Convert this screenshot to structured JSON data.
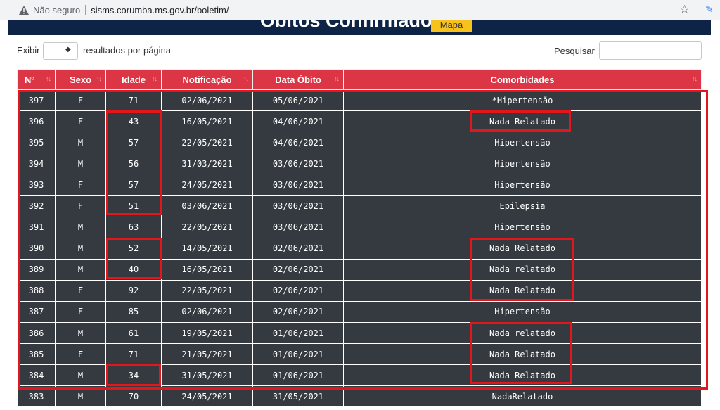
{
  "browser": {
    "not_secure": "Não seguro",
    "url": "sisms.corumba.ms.gov.br/boletim/"
  },
  "header": {
    "title": "Óbitos Confirmados",
    "map_button": "Mapa"
  },
  "controls": {
    "show_label": "Exibir",
    "page_size_arrow": "◆",
    "per_page_label": "resultados por página",
    "search_label": "Pesquisar",
    "search_value": ""
  },
  "table": {
    "headers": [
      "Nº",
      "Sexo",
      "Idade",
      "Notificação",
      "Data Óbito",
      "Comorbidades"
    ],
    "rows": [
      [
        "397",
        "F",
        "71",
        "02/06/2021",
        "05/06/2021",
        "*Hipertensão"
      ],
      [
        "396",
        "F",
        "43",
        "16/05/2021",
        "04/06/2021",
        "Nada Relatado"
      ],
      [
        "395",
        "M",
        "57",
        "22/05/2021",
        "04/06/2021",
        "Hipertensão"
      ],
      [
        "394",
        "M",
        "56",
        "31/03/2021",
        "03/06/2021",
        "Hipertensão"
      ],
      [
        "393",
        "F",
        "57",
        "24/05/2021",
        "03/06/2021",
        "Hipertensão"
      ],
      [
        "392",
        "F",
        "51",
        "03/06/2021",
        "03/06/2021",
        "Epilepsia"
      ],
      [
        "391",
        "M",
        "63",
        "22/05/2021",
        "03/06/2021",
        "Hipertensão"
      ],
      [
        "390",
        "M",
        "52",
        "14/05/2021",
        "02/06/2021",
        "Nada Relatado"
      ],
      [
        "389",
        "M",
        "40",
        "16/05/2021",
        "02/06/2021",
        "Nada relatado"
      ],
      [
        "388",
        "F",
        "92",
        "22/05/2021",
        "02/06/2021",
        "Nada Relatado"
      ],
      [
        "387",
        "F",
        "85",
        "02/06/2021",
        "02/06/2021",
        "Hipertensão"
      ],
      [
        "386",
        "M",
        "61",
        "19/05/2021",
        "01/06/2021",
        "Nada relatado"
      ],
      [
        "385",
        "F",
        "71",
        "21/05/2021",
        "01/06/2021",
        "Nada Relatado"
      ],
      [
        "384",
        "M",
        "34",
        "31/05/2021",
        "01/06/2021",
        "Nada Relatado"
      ],
      [
        "383",
        "M",
        "70",
        "24/05/2021",
        "31/05/2021",
        "NadaRelatado"
      ]
    ]
  },
  "colors": {
    "header_red": "#dc3545",
    "row_dark": "#343a40",
    "navy": "#0e2447",
    "highlight": "#e3161c",
    "button_yellow": "#f7c21b"
  }
}
